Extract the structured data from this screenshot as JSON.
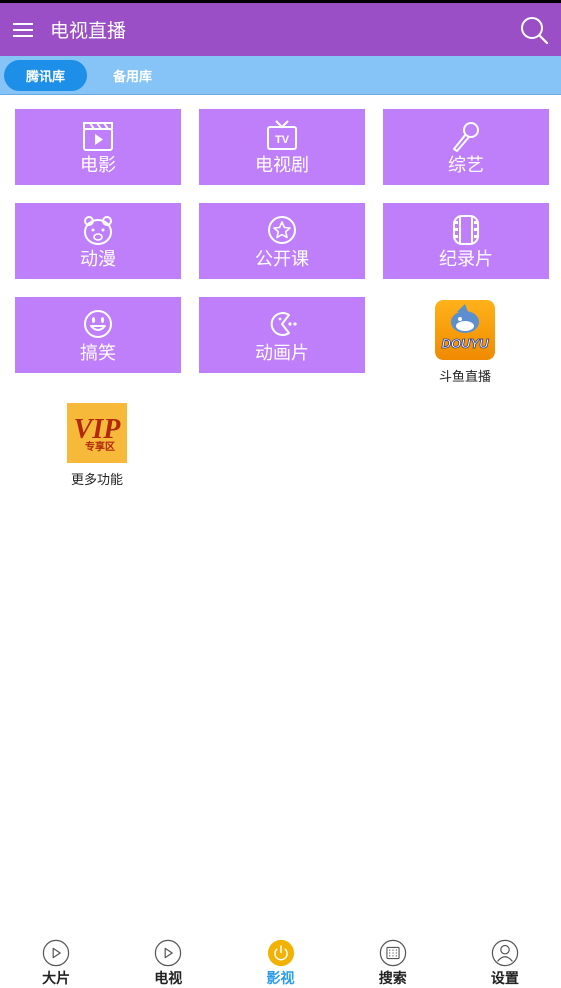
{
  "app": {
    "title": "电视直播"
  },
  "tabs": [
    {
      "label": "腾讯库",
      "active": true
    },
    {
      "label": "备用库",
      "active": false
    }
  ],
  "categories": [
    {
      "label": "电影",
      "icon": "movie-clapper-icon"
    },
    {
      "label": "电视剧",
      "icon": "tv-icon"
    },
    {
      "label": "综艺",
      "icon": "microphone-icon"
    },
    {
      "label": "动漫",
      "icon": "bear-icon"
    },
    {
      "label": "公开课",
      "icon": "star-badge-icon"
    },
    {
      "label": "纪录片",
      "icon": "film-reel-icon"
    },
    {
      "label": "搞笑",
      "icon": "smiley-icon"
    },
    {
      "label": "动画片",
      "icon": "pacman-icon"
    }
  ],
  "apps": [
    {
      "label": "斗鱼直播",
      "icon": "douyu-logo",
      "logo_text": "DOUYU"
    },
    {
      "label": "更多功能",
      "icon": "vip-logo",
      "logo_text": "VIP",
      "logo_subtext": "专享区"
    }
  ],
  "bottom_nav": [
    {
      "label": "大片",
      "icon": "play-circle-icon",
      "active": false
    },
    {
      "label": "电视",
      "icon": "play-circle-icon",
      "active": false
    },
    {
      "label": "影视",
      "icon": "power-icon",
      "active": true
    },
    {
      "label": "搜索",
      "icon": "keypad-icon",
      "active": false
    },
    {
      "label": "设置",
      "icon": "user-icon",
      "active": false
    }
  ],
  "colors": {
    "appbar": "#9a4fc6",
    "tabbar": "#86c3f7",
    "tab_active": "#1e8fe8",
    "tile": "#bf7ffb",
    "nav_active": "#2a9be8",
    "nav_active_icon": "#f2b205"
  }
}
